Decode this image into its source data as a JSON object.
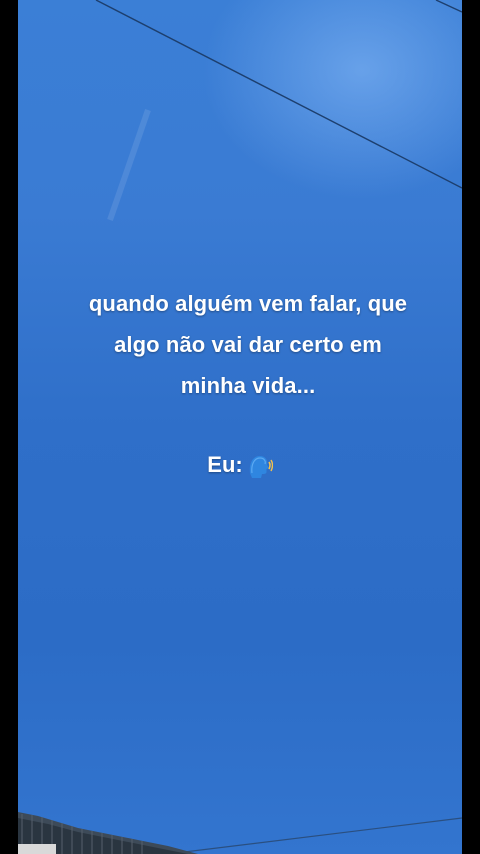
{
  "caption": {
    "lines": [
      "quando alguém vem falar, que",
      "algo não vai dar certo em",
      "minha vida..."
    ]
  },
  "reply": {
    "text": "Eu:",
    "emoji": "speaking-head-emoji"
  },
  "colors": {
    "sky_top": "#3b7fd6",
    "sky_bottom": "#2c6cc6",
    "text": "#ffffff",
    "border": "#000000"
  }
}
